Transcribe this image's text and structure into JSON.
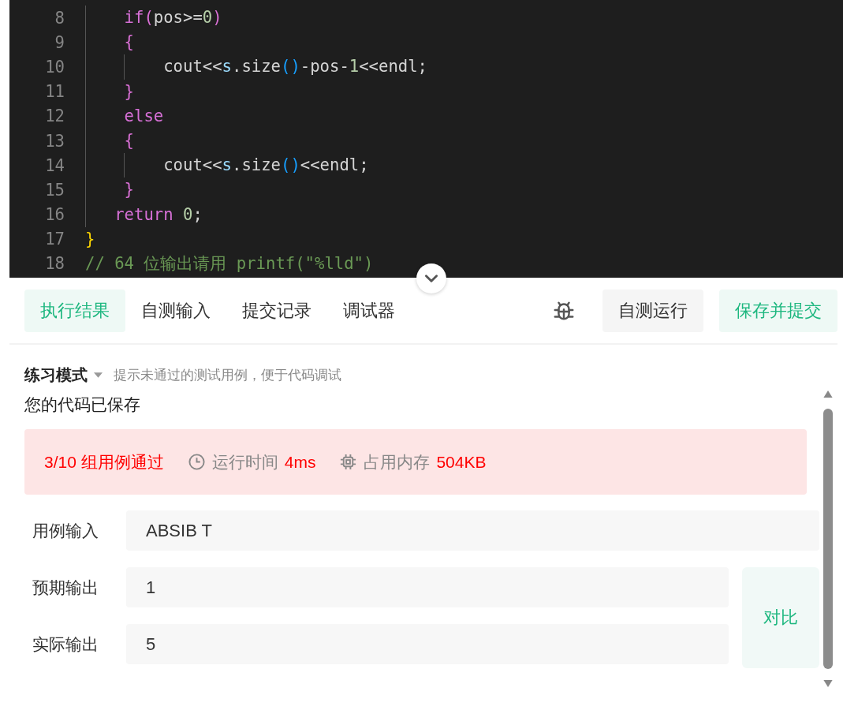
{
  "editor": {
    "lines": [
      {
        "number": "8",
        "tokens": [
          {
            "kind": "keyword",
            "text": "    if"
          },
          {
            "kind": "bracket1",
            "text": "("
          },
          {
            "kind": "plain",
            "text": "pos>="
          },
          {
            "kind": "number",
            "text": "0"
          },
          {
            "kind": "bracket1",
            "text": ")"
          }
        ]
      },
      {
        "number": "9",
        "tokens": [
          {
            "kind": "bracket1",
            "text": "    {"
          }
        ]
      },
      {
        "number": "10",
        "tokens": [
          {
            "kind": "plain",
            "text": "        cout<<"
          },
          {
            "kind": "variable",
            "text": "s"
          },
          {
            "kind": "plain",
            "text": ".size"
          },
          {
            "kind": "bracket2",
            "text": "()"
          },
          {
            "kind": "plain",
            "text": "-pos-"
          },
          {
            "kind": "number",
            "text": "1"
          },
          {
            "kind": "plain",
            "text": "<<endl;"
          }
        ]
      },
      {
        "number": "11",
        "tokens": [
          {
            "kind": "bracket1",
            "text": "    }"
          }
        ]
      },
      {
        "number": "12",
        "tokens": [
          {
            "kind": "keyword",
            "text": "    else"
          }
        ]
      },
      {
        "number": "13",
        "tokens": [
          {
            "kind": "bracket1",
            "text": "    {"
          }
        ]
      },
      {
        "number": "14",
        "tokens": [
          {
            "kind": "plain",
            "text": "        cout<<"
          },
          {
            "kind": "variable",
            "text": "s"
          },
          {
            "kind": "plain",
            "text": ".size"
          },
          {
            "kind": "bracket2",
            "text": "()"
          },
          {
            "kind": "plain",
            "text": "<<endl;"
          }
        ]
      },
      {
        "number": "15",
        "tokens": [
          {
            "kind": "bracket1",
            "text": "    }"
          }
        ]
      },
      {
        "number": "16",
        "tokens": [
          {
            "kind": "keyword",
            "text": "   return "
          },
          {
            "kind": "number",
            "text": "0"
          },
          {
            "kind": "plain",
            "text": ";"
          }
        ]
      },
      {
        "number": "17",
        "tokens": [
          {
            "kind": "bracket0",
            "text": "}"
          }
        ]
      },
      {
        "number": "18",
        "tokens": [
          {
            "kind": "comment",
            "text": "// 64 位输出请用 printf(\"%lld\")"
          }
        ]
      }
    ]
  },
  "tabs": [
    {
      "label": "执行结果",
      "selected": true
    },
    {
      "label": "自测输入",
      "selected": false
    },
    {
      "label": "提交记录",
      "selected": false
    },
    {
      "label": "调试器",
      "selected": false
    }
  ],
  "actions": [
    {
      "kind": "secondary",
      "label": "自测运行"
    },
    {
      "kind": "primary",
      "label": "保存并提交"
    }
  ],
  "mode": {
    "label": "练习模式",
    "hint": "提示未通过的测试用例，便于代码调试"
  },
  "status": "您的代码已保存",
  "result": {
    "summary": "3/10 组用例通过",
    "time_label": "运行时间",
    "time_value": "4ms",
    "memory_label": "占用内存",
    "memory_value": "504KB"
  },
  "fields": [
    {
      "label": "用例输入",
      "value": "ABSIB T"
    },
    {
      "label": "预期输出",
      "value": "1"
    },
    {
      "label": "实际输出",
      "value": "5"
    }
  ],
  "compare_button": "对比"
}
